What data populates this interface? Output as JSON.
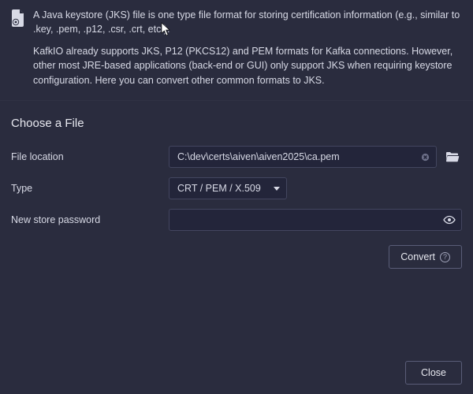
{
  "info": {
    "paragraph1": "A Java keystore (JKS) file is one type file format for storing certification information (e.g., similar to .key, .pem, .p12, .csr, .crt, etc.).",
    "paragraph2": "KafkIO already supports JKS, P12 (PKCS12) and PEM formats for Kafka connections. However, other most JRE-based applications (back-end or GUI) only support JKS when requiring keystore configuration. Here you can convert other common formats to JKS."
  },
  "form": {
    "section_title": "Choose a File",
    "file_location_label": "File location",
    "file_location_value": "C:\\dev\\certs\\aiven\\aiven2025\\ca.pem",
    "type_label": "Type",
    "type_value": "CRT / PEM / X.509",
    "password_label": "New store password",
    "password_value": ""
  },
  "buttons": {
    "convert": "Convert",
    "close": "Close"
  }
}
